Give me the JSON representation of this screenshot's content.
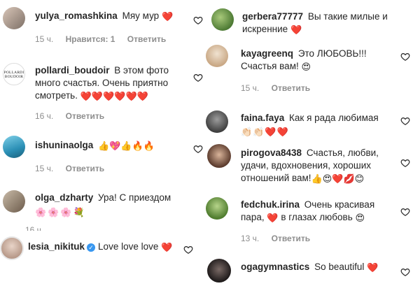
{
  "left": [
    {
      "username": "yulya_romashkina",
      "text": "Мяу мур",
      "emoji": "❤️",
      "time": "15 ч.",
      "likes": "Нравится: 1",
      "reply": "Ответить"
    },
    {
      "username": "pollardi_boudoir",
      "text": "В этом фото много счастья. Очень приятно смотреть.",
      "emoji": "❤️❤️❤️❤️❤️❤️",
      "avatar_text": "POLLARDI BOUDOIR",
      "time": "16 ч.",
      "reply": "Ответить"
    },
    {
      "username": "ishuninaolga",
      "text": "",
      "emoji": "👍💖👍🔥🔥",
      "time": "15 ч.",
      "reply": "Ответить"
    },
    {
      "username": "olga_dzharty",
      "text": "Ура! С приездом",
      "emoji": "🌸🌸🌸💐",
      "time": "16 ч."
    },
    {
      "username": "lesia_nikituk",
      "text": "Love love love",
      "emoji": "❤️"
    }
  ],
  "right": [
    {
      "username": "gerbera77777",
      "text": "Вы такие милые и искренние",
      "emoji": "❤️"
    },
    {
      "username": "kayagreenq",
      "text": "Это ЛЮБОВЬ!!! Счастья вам!",
      "emoji": "😍",
      "time": "15 ч.",
      "reply": "Ответить"
    },
    {
      "username": "faina.faya",
      "text": "Как я рада любимая",
      "emoji": "👏🏻👏🏻❤️❤️"
    },
    {
      "username": "pirogova8438",
      "text": "Счастья, любви, удачи, вдохновения, хороших отношений вам!",
      "emoji": "👍😍❤️💋😊"
    },
    {
      "username": "fedchuk.irina",
      "text": "Очень красивая пара,",
      "text2": "в глазах любовь",
      "emoji": "❤️",
      "emoji2": "😍",
      "time": "13 ч.",
      "reply": "Ответить"
    },
    {
      "username": "ogagymnastics",
      "text": "So beautiful",
      "emoji": "❤️"
    }
  ],
  "colors": {
    "text": "#262626",
    "meta": "#8e8e8e",
    "heart": "#ed4956",
    "verified": "#3897f0"
  }
}
